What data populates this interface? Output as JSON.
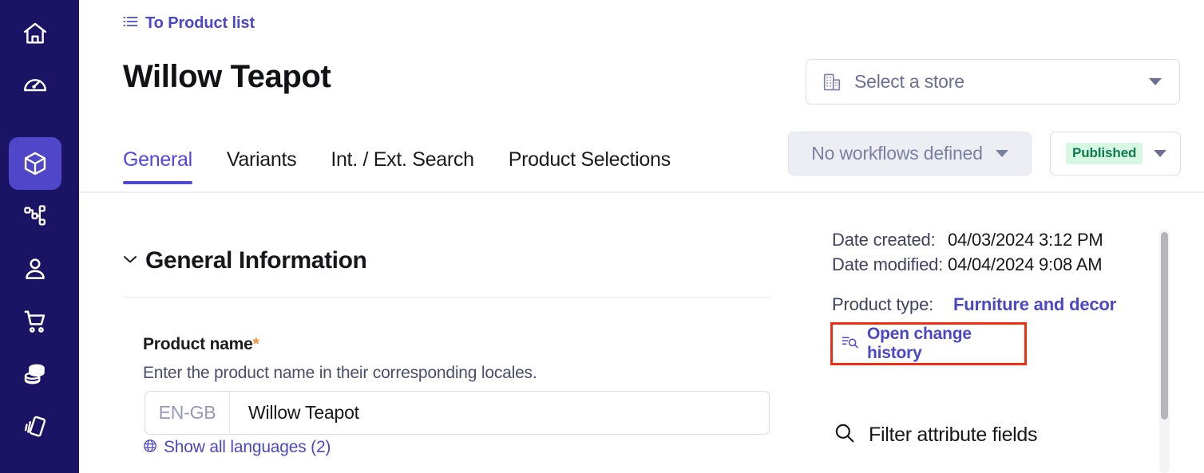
{
  "sidebar": {
    "items": [
      {
        "name": "home",
        "icon": "home-icon",
        "active": false
      },
      {
        "name": "dashboard",
        "icon": "gauge-icon",
        "active": false
      },
      {
        "name": "products",
        "icon": "cube-icon",
        "active": true
      },
      {
        "name": "categories",
        "icon": "hierarchy-icon",
        "active": false
      },
      {
        "name": "customers",
        "icon": "person-icon",
        "active": false
      },
      {
        "name": "orders",
        "icon": "shopping-cart-icon",
        "active": false
      },
      {
        "name": "prices",
        "icon": "coins-stack-icon",
        "active": false
      },
      {
        "name": "discounts",
        "icon": "price-tag-icon",
        "active": false
      }
    ]
  },
  "breadcrumb": {
    "icon": "list-icon",
    "label": "To Product list"
  },
  "header": {
    "title": "Willow Teapot"
  },
  "store_select": {
    "icon": "building-icon",
    "label": "Select a store",
    "caret": "chevron-down-icon"
  },
  "workflow_select": {
    "label": "No workflows defined",
    "caret": "chevron-down-icon",
    "disabled": true
  },
  "status_select": {
    "badge": "Published",
    "badge_bg": "#d6f8e2",
    "badge_color": "#0e7a4d",
    "caret": "chevron-down-icon"
  },
  "tabs": [
    {
      "label": "General",
      "active": true
    },
    {
      "label": "Variants",
      "active": false
    },
    {
      "label": "Int. / Ext. Search",
      "active": false
    },
    {
      "label": "Product Selections",
      "active": false
    }
  ],
  "section": {
    "chevron": "chevron-down-icon",
    "title": "General Information"
  },
  "form": {
    "field_label": "Product name",
    "required_marker": "*",
    "field_hint": "Enter the product name in their corresponding locales.",
    "locale": "EN-GB",
    "value": "Willow Teapot",
    "show_languages": "Show all languages (2)",
    "show_languages_icon": "globe-icon"
  },
  "meta": {
    "date_created_key": "Date created:",
    "date_created_value": "04/03/2024 3:12 PM",
    "date_modified_key": "Date modified:",
    "date_modified_value": "04/04/2024 9:08 AM",
    "product_type_key": "Product type:",
    "product_type_value": "Furniture and decor",
    "change_history_label": "Open change history",
    "change_history_icon": "history-search-icon",
    "highlight_color": "#ee2d11"
  },
  "filter": {
    "icon": "search-icon",
    "label": "Filter attribute fields"
  },
  "colors": {
    "sidebar_bg": "#1b1464",
    "sidebar_active": "#4f46c9",
    "link": "#4b47c9",
    "tab_active": "#4f46e5",
    "required": "#f59034"
  }
}
